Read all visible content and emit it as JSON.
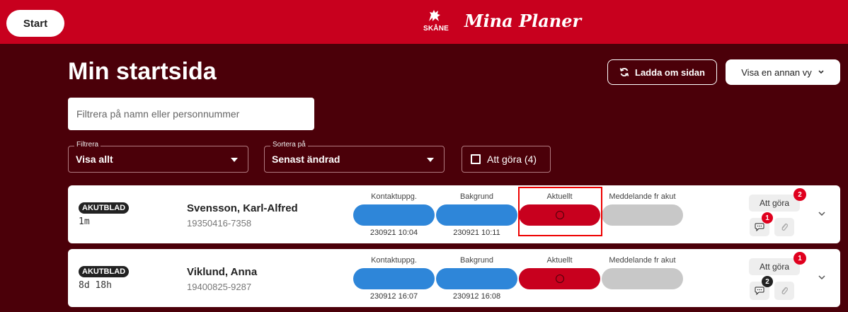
{
  "topbar": {
    "start_label": "Start",
    "logo_word": "SKÅNE",
    "app_title": "Mina Planer",
    "brand_color": "#c8001e"
  },
  "main": {
    "page_title": "Min startsida",
    "reload_label": "Ladda om sidan",
    "view_label": "Visa en annan vy",
    "search_placeholder": "Filtrera på namn eller personnummer",
    "filter": {
      "label": "Filtrera",
      "value": "Visa allt"
    },
    "sort": {
      "label": "Sortera på",
      "value": "Senast ändrad"
    },
    "todo_filter_label": "Att göra (4)",
    "background_color": "#4b0009"
  },
  "columns": [
    "Kontaktuppg.",
    "Bakgrund",
    "Aktuellt",
    "Meddelande fr akut"
  ],
  "patients": [
    {
      "tag": "AKUTBLAD",
      "age": "1m",
      "name": "Svensson, Karl-Alfred",
      "pnr": "19350416-7358",
      "contact_stamp": "230921 10:04",
      "background_stamp": "230921 10:11",
      "todo_label": "Att göra",
      "todo_count": "2",
      "message_count": "1",
      "message_badge_color": "#e0001e"
    },
    {
      "tag": "AKUTBLAD",
      "age": "8d 18h",
      "name": "Viklund, Anna",
      "pnr": "19400825-9287",
      "contact_stamp": "230912 16:07",
      "background_stamp": "230912 16:08",
      "todo_label": "Att göra",
      "todo_count": "1",
      "message_count": "2",
      "message_badge_color": "#222222"
    }
  ],
  "colors": {
    "blue": "#2e86d9",
    "red": "#c8001e",
    "gray": "#c8c8c8",
    "highlight": "#ee0000"
  }
}
